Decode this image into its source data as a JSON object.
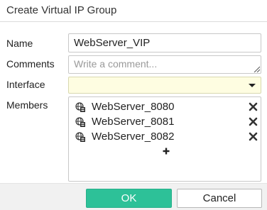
{
  "dialog": {
    "title": "Create Virtual IP Group"
  },
  "form": {
    "name_label": "Name",
    "name_value": "WebServer_VIP",
    "comments_label": "Comments",
    "comments_placeholder": "Write a comment...",
    "interface_label": "Interface",
    "interface_value": "",
    "members_label": "Members",
    "members": [
      {
        "label": "WebServer_8080",
        "icon": "virtual-ip-icon"
      },
      {
        "label": "WebServer_8081",
        "icon": "virtual-ip-icon"
      },
      {
        "label": "WebServer_8082",
        "icon": "virtual-ip-icon"
      }
    ],
    "add_member_icon": "plus-icon"
  },
  "footer": {
    "ok_label": "OK",
    "cancel_label": "Cancel"
  },
  "colors": {
    "ok_button": "#2dc198",
    "interface_highlight": "#fefde1",
    "footer_bg": "#f1f1f1"
  }
}
